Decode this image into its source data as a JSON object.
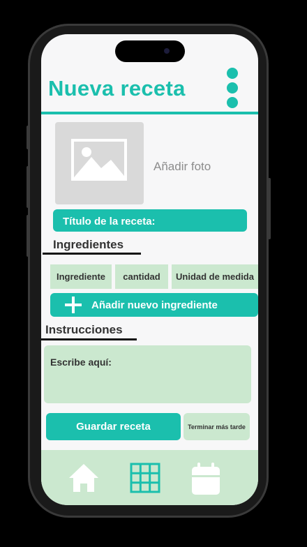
{
  "header": {
    "title": "Nueva receta",
    "menu_icon": "more-vertical-icon"
  },
  "photo": {
    "label": "Añadir foto",
    "icon": "image-placeholder-icon"
  },
  "recipe_title": {
    "label": "Título de la receta:"
  },
  "ingredients": {
    "heading": "Ingredientes",
    "fields": [
      "Ingrediente",
      "cantidad",
      "Unidad de medida"
    ],
    "add_label": "Añadir nuevo ingrediente"
  },
  "instructions": {
    "heading": "Instrucciones",
    "placeholder": "Escribe aquí:"
  },
  "actions": {
    "save_label": "Guardar receta",
    "later_label": "Terminar más tarde"
  },
  "nav": {
    "items": [
      "home-icon",
      "grid-icon",
      "calendar-icon"
    ]
  },
  "colors": {
    "accent": "#1bbfad",
    "light": "#cbe8cf",
    "background": "#f7f7f8"
  }
}
